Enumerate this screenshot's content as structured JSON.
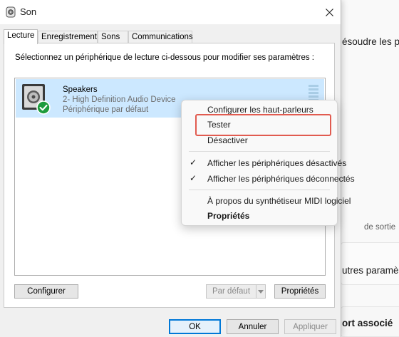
{
  "background_window": {
    "line1": "ésoudre les p",
    "line2": "utres paramè",
    "line3": "de sortie",
    "line4": "ort associé"
  },
  "dialog": {
    "title": "Son",
    "tabs": [
      {
        "label": "Lecture",
        "active": true
      },
      {
        "label": "Enregistrement",
        "active": false
      },
      {
        "label": "Sons",
        "active": false
      },
      {
        "label": "Communications",
        "active": false
      }
    ],
    "instruction": "Sélectionnez un périphérique de lecture ci-dessous pour modifier ses paramètres :",
    "device": {
      "name": "Speakers",
      "description": "2- High Definition Audio Device",
      "status": "Périphérique par défaut"
    },
    "buttons": {
      "configure": "Configurer",
      "set_default": "Par défaut",
      "properties": "Propriétés"
    },
    "footer": {
      "ok": "OK",
      "cancel": "Annuler",
      "apply": "Appliquer"
    }
  },
  "context_menu": {
    "items": [
      {
        "label": "Configurer les haut-parleurs",
        "checked": false
      },
      {
        "label": "Tester",
        "checked": false,
        "highlighted": true
      },
      {
        "label": "Désactiver",
        "checked": false
      },
      {
        "label": "Afficher les périphériques désactivés",
        "checked": true
      },
      {
        "label": "Afficher les périphériques déconnectés",
        "checked": true
      },
      {
        "label": "À propos du synthétiseur MIDI logiciel",
        "checked": false
      },
      {
        "label": "Propriétés",
        "checked": false,
        "bold": true
      }
    ],
    "check_glyph": "✓"
  },
  "colors": {
    "selection": "#cce8ff",
    "highlight_border": "#e15b50",
    "default_badge": "#1e9c3e"
  }
}
